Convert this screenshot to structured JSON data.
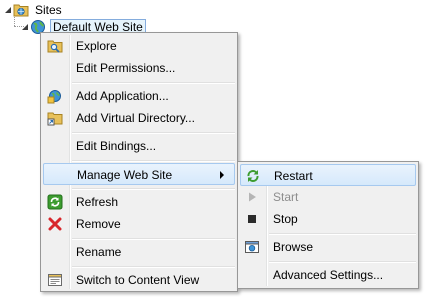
{
  "tree": {
    "sites_label": "Sites",
    "site_label": "Default Web Site"
  },
  "context_menu": {
    "explore": "Explore",
    "edit_permissions": "Edit Permissions...",
    "add_application": "Add Application...",
    "add_virtual_directory": "Add Virtual Directory...",
    "edit_bindings": "Edit Bindings...",
    "manage_web_site": "Manage Web Site",
    "refresh": "Refresh",
    "remove": "Remove",
    "rename": "Rename",
    "switch_to_content_view": "Switch to Content View"
  },
  "submenu": {
    "restart": "Restart",
    "start": "Start",
    "stop": "Stop",
    "browse": "Browse",
    "advanced_settings": "Advanced Settings..."
  },
  "colors": {
    "highlight_border": "#a6c9ef",
    "menu_background": "#f0f0f0",
    "disabled_text": "#8d8d8d"
  }
}
